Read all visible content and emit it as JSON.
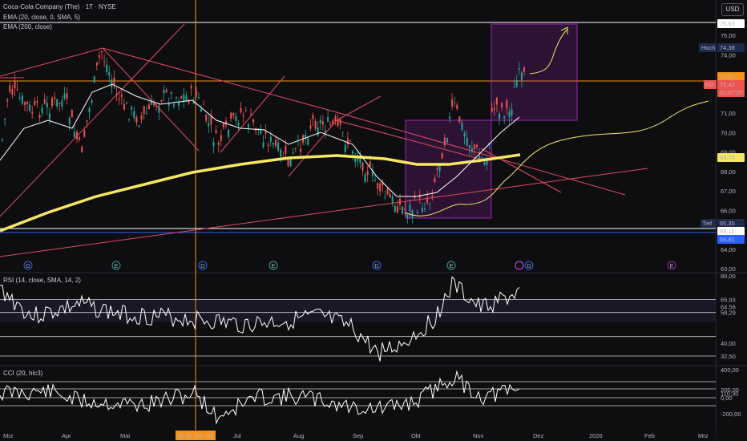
{
  "header": {
    "title": "Coca-Cola Company (The) · 1T · NYSE",
    "ind1": "EMA (20, close, 0, SMA, 5)",
    "ind2": "EMA (200, close)",
    "currency": "USD"
  },
  "rsi": {
    "title": "RSI (14, close, SMA, 14, 2)"
  },
  "cci": {
    "title": "CCI (20, hlc3)"
  },
  "tags": {
    "high_label": "Hoch",
    "high_value": "74,38",
    "low_label": "Tief",
    "low_value": "65,35",
    "ko_label": "KO",
    "ko_value": "72,42",
    "ko_timer": "01:07:07",
    "ema200_value": "68,78",
    "top_value": "75,63",
    "blue1": "65,11",
    "blue2": "64,81",
    "orange_value": "72,57"
  },
  "crosshair_date": "Di 10 Jun '25",
  "price_axis": [
    "75,00",
    "74,00",
    "73,00",
    "72,00",
    "71,00",
    "70,00",
    "69,00",
    "68,00",
    "67,00",
    "66,00",
    "65,00",
    "64,00",
    "63,00"
  ],
  "rsi_axis": [
    "80,00",
    "65,93",
    "64,56",
    "58,29",
    "40,00",
    "32,50"
  ],
  "cci_axis": [
    "400,00",
    "200,00",
    "110,30",
    "0,00",
    "-200,00"
  ],
  "time_axis": [
    "Mrz",
    "Apr",
    "Mai",
    "Jul",
    "Aug",
    "Sep",
    "Okt",
    "Nov",
    "Dez",
    "2026",
    "Feb",
    "Mrz"
  ],
  "event_markers": [
    "D",
    "E",
    "D",
    "E",
    "D",
    "E",
    "D",
    "E"
  ],
  "colors": {
    "up": "#26a69a",
    "down": "#ef5350",
    "ema20": "#ffffff",
    "ema200": "#f5e663",
    "trend": "#e04b64",
    "box": "#9c27b0",
    "projection": "#f5e663",
    "crosshair": "#f7931a"
  },
  "chart_data": {
    "type": "line",
    "title": "Coca-Cola Company (The) · 1T · NYSE",
    "x_labels": [
      "Mrz",
      "Apr",
      "Mai",
      "Jun",
      "Jul",
      "Aug",
      "Sep",
      "Okt",
      "Nov",
      "Dez"
    ],
    "series": [
      {
        "name": "EMA (20, close, 0, SMA, 5)",
        "values": [
          68.7,
          70.5,
          71.4,
          71.3,
          70.0,
          69.3,
          69.5,
          66.6,
          67.6,
          70.5
        ]
      },
      {
        "name": "EMA (200, close)",
        "values": [
          65.1,
          66.0,
          66.9,
          67.8,
          68.4,
          68.6,
          68.6,
          68.2,
          68.4,
          68.78
        ]
      }
    ],
    "ylim": [
      63,
      76
    ]
  }
}
